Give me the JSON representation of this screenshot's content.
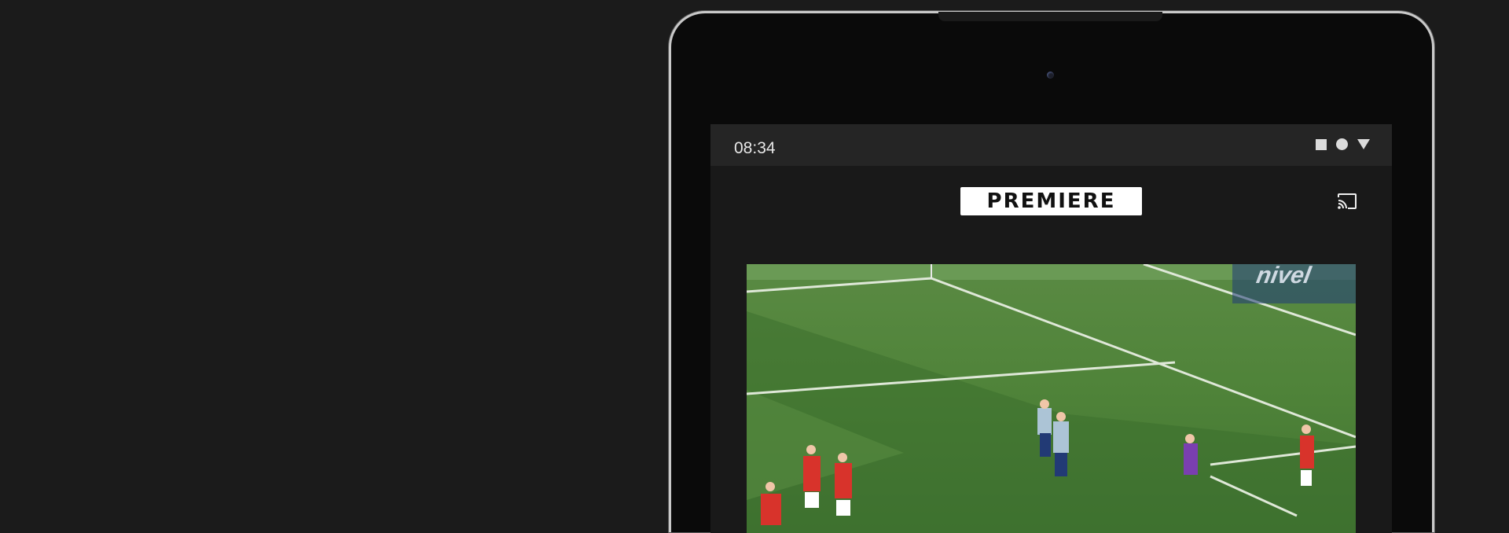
{
  "status_bar": {
    "time": "08:34",
    "icons": [
      "stop-square-icon",
      "circle-icon",
      "triangle-down-icon"
    ]
  },
  "app_bar": {
    "logo_text": "PREMIERE",
    "cast_icon": "cast-icon"
  },
  "video": {
    "board_text": "nivel"
  },
  "colors": {
    "background": "#1b1b1b",
    "tablet_frame": "#c9c9c9",
    "status_bar": "#252525",
    "app_background": "#191919",
    "logo_bg": "#ffffff",
    "pitch_green": "#4f8339"
  }
}
